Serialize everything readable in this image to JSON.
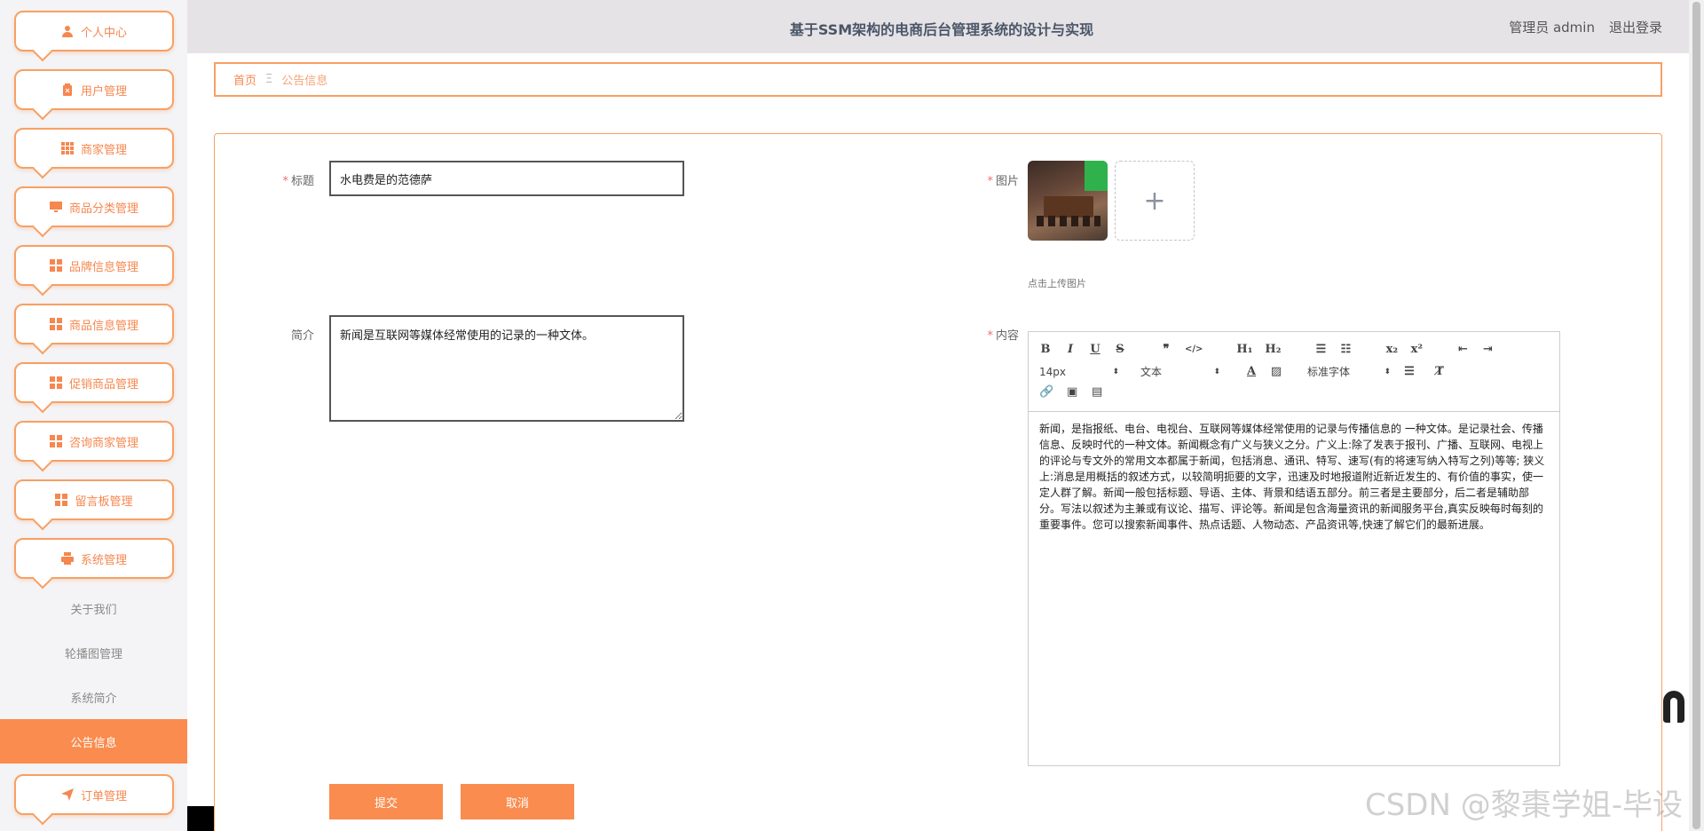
{
  "sidebar": {
    "items": [
      {
        "label": "个人中心",
        "icon": "user-icon"
      },
      {
        "label": "用户管理",
        "icon": "clipboard-icon"
      },
      {
        "label": "商家管理",
        "icon": "grid-icon"
      },
      {
        "label": "商品分类管理",
        "icon": "monitor-icon"
      },
      {
        "label": "品牌信息管理",
        "icon": "grid-icon"
      },
      {
        "label": "商品信息管理",
        "icon": "grid-icon"
      },
      {
        "label": "促销商品管理",
        "icon": "grid-icon"
      },
      {
        "label": "咨询商家管理",
        "icon": "grid-icon"
      },
      {
        "label": "留言板管理",
        "icon": "grid-icon"
      },
      {
        "label": "系统管理",
        "icon": "printer-icon"
      }
    ],
    "system_sub": [
      {
        "label": "关于我们",
        "active": false
      },
      {
        "label": "轮播图管理",
        "active": false
      },
      {
        "label": "系统简介",
        "active": false
      },
      {
        "label": "公告信息",
        "active": true
      }
    ],
    "order_item": {
      "label": "订单管理",
      "icon": "send-icon"
    }
  },
  "header": {
    "title": "基于SSM架构的电商后台管理系统的设计与实现",
    "admin_label": "管理员 admin",
    "logout_label": "退出登录"
  },
  "breadcrumb": {
    "home": "首页",
    "separator": "Ξ",
    "current": "公告信息"
  },
  "form": {
    "title_label": "标题",
    "title_value": "水电费是的范德萨",
    "summary_label": "简介",
    "summary_value": "新闻是互联网等媒体经常使用的记录的一种文体。",
    "image_label": "图片",
    "upload_hint": "点击上传图片",
    "content_label": "内容",
    "editor": {
      "size_value": "14px",
      "header_value": "文本",
      "font_value": "标准字体",
      "content": "新闻，是指报纸、电台、电视台、互联网等媒体经常使用的记录与传播信息的 一种文体。是记录社会、传播信息、反映时代的一种文体。新闻概念有广义与狭义之分。广义上:除了发表于报刊、广播、互联网、电视上的评论与专文外的常用文本都属于新闻，包括消息、通讯、特写、速写(有的将速写纳入特写之列)等等; 狭义上:消息是用概括的叙述方式，以较简明扼要的文字，迅速及时地报道附近新近发生的、有价值的事实，使一定人群了解。新闻一般包括标题、导语、主体、背景和结语五部分。前三者是主要部分，后二者是辅助部分。写法以叙述为主兼或有议论、描写、评论等。新闻是包含海量资讯的新闻服务平台,真实反映每时每刻的重要事件。您可以搜索新闻事件、热点话题、人物动态、产品资讯等,快速了解它们的最新进展。"
    },
    "submit_label": "提交",
    "cancel_label": "取消"
  },
  "watermark": "CSDN @黎棗学姐-毕设",
  "colors": {
    "accent": "#f98c4e",
    "border_accent": "#f7a064",
    "required": "#f56c6c"
  }
}
